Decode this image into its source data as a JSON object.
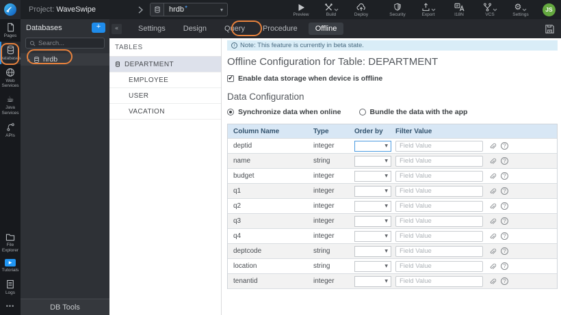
{
  "annotation_color": "#e8823d",
  "topbar": {
    "project_prefix": "Project:",
    "project_name": "WaveSwipe",
    "db_selector": {
      "value": "hrdb",
      "star": "*"
    },
    "actions": {
      "preview": "Preview",
      "build": "Build",
      "deploy": "Deploy",
      "security": "Security",
      "export": "Export",
      "i18n": "I18N",
      "vcs": "VCS",
      "settings": "Settings"
    },
    "avatar": "JS"
  },
  "sidebar": {
    "items": [
      {
        "label": "Pages",
        "icon": "page-icon",
        "active": false
      },
      {
        "label": "Databases",
        "icon": "database-icon",
        "active": true
      },
      {
        "label": "Web Services",
        "icon": "globe-icon",
        "active": false
      },
      {
        "label": "Java Services",
        "icon": "coffee-icon",
        "active": false
      },
      {
        "label": "APIs",
        "icon": "api-icon",
        "active": false
      }
    ],
    "bottom": [
      {
        "label": "File Explorer",
        "icon": "folder-icon"
      },
      {
        "label": "Tutorials",
        "icon": "play-icon"
      },
      {
        "label": "Logs",
        "icon": "logs-icon"
      }
    ],
    "more": "•••"
  },
  "db_panel": {
    "title": "Databases",
    "add_label": "+",
    "search_placeholder": "Search...",
    "item": "hrdb",
    "footer": "DB Tools"
  },
  "tabs": {
    "items": [
      "Settings",
      "Design",
      "Query",
      "Procedure",
      "Offline"
    ],
    "active": "Offline"
  },
  "tables_panel": {
    "title": "TABLES",
    "items": [
      "DEPARTMENT",
      "EMPLOYEE",
      "USER",
      "VACATION"
    ],
    "selected": "DEPARTMENT"
  },
  "main": {
    "note": "Note: This feature is currently in beta state.",
    "title": "Offline Configuration for Table: DEPARTMENT",
    "checkbox_label": "Enable data storage when device is offline",
    "checkbox_checked": true,
    "check_glyph": "✔",
    "section_title": "Data Configuration",
    "radio_online": "Synchronize data when online",
    "radio_bundle": "Bundle the data with the app",
    "radio_selected": "Synchronize data when online",
    "table": {
      "headers": [
        "Column Name",
        "Type",
        "Order by",
        "Filter Value"
      ],
      "filter_placeholder": "Field Value",
      "rows": [
        {
          "name": "deptid",
          "type": "integer"
        },
        {
          "name": "name",
          "type": "string"
        },
        {
          "name": "budget",
          "type": "integer"
        },
        {
          "name": "q1",
          "type": "integer"
        },
        {
          "name": "q2",
          "type": "integer"
        },
        {
          "name": "q3",
          "type": "integer"
        },
        {
          "name": "q4",
          "type": "integer"
        },
        {
          "name": "deptcode",
          "type": "string"
        },
        {
          "name": "location",
          "type": "string"
        },
        {
          "name": "tenantid",
          "type": "integer"
        }
      ]
    }
  }
}
